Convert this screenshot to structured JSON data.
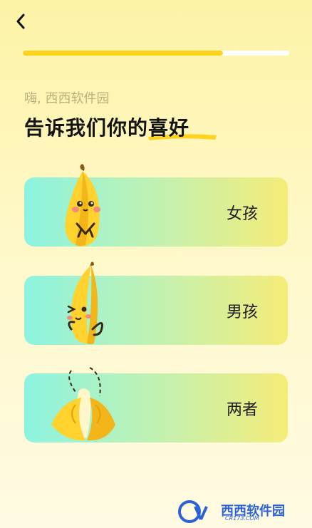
{
  "header": {
    "back_icon": "chevron-left-icon"
  },
  "progress": {
    "value": 0.75,
    "fill_color": "#ffd21c",
    "track_color": "#ffffff"
  },
  "greeting": "嗨, 西西软件园",
  "title": "告诉我们你的喜好",
  "options": [
    {
      "label": "女孩",
      "illustration": "banana-shy-icon"
    },
    {
      "label": "男孩",
      "illustration": "banana-wink-icon"
    },
    {
      "label": "两者",
      "illustration": "banana-peeled-icon"
    }
  ],
  "watermark": {
    "brand": "西西软件园",
    "domain": "CR173.COM"
  }
}
